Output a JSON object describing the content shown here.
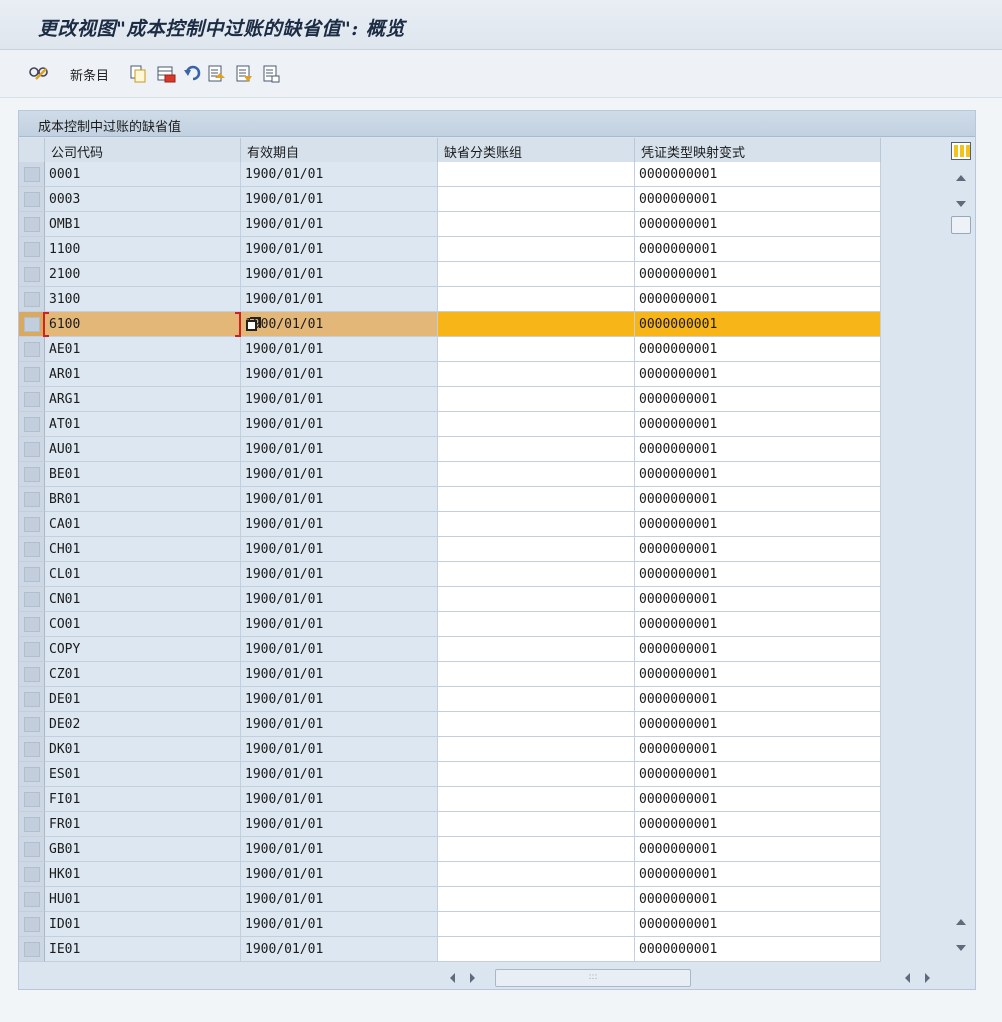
{
  "window": {
    "title": "更改视图\"成本控制中过账的缺省值\": 概览"
  },
  "toolbar": {
    "items": [
      {
        "icon": "glasses-icon"
      },
      {
        "label": "新条目",
        "icon": "new-entry"
      },
      {
        "icon": "copy-icon"
      },
      {
        "icon": "delete-icon"
      },
      {
        "icon": "undo-icon"
      },
      {
        "icon": "select-all-icon"
      },
      {
        "icon": "select-block-icon"
      },
      {
        "icon": "deselect-all-icon"
      }
    ]
  },
  "table": {
    "title": "成本控制中过账的缺省值",
    "columns": [
      "公司代码",
      "有效期自",
      "缺省分类账组",
      "凭证类型映射变式"
    ],
    "selected_row": 6,
    "rows": [
      [
        "0001",
        "1900/01/01",
        "",
        "0000000001"
      ],
      [
        "0003",
        "1900/01/01",
        "",
        "0000000001"
      ],
      [
        "OMB1",
        "1900/01/01",
        "",
        "0000000001"
      ],
      [
        "1100",
        "1900/01/01",
        "",
        "0000000001"
      ],
      [
        "2100",
        "1900/01/01",
        "",
        "0000000001"
      ],
      [
        "3100",
        "1900/01/01",
        "",
        "0000000001"
      ],
      [
        "6100",
        "1900/01/01",
        "",
        "0000000001"
      ],
      [
        "AE01",
        "1900/01/01",
        "",
        "0000000001"
      ],
      [
        "AR01",
        "1900/01/01",
        "",
        "0000000001"
      ],
      [
        "ARG1",
        "1900/01/01",
        "",
        "0000000001"
      ],
      [
        "AT01",
        "1900/01/01",
        "",
        "0000000001"
      ],
      [
        "AU01",
        "1900/01/01",
        "",
        "0000000001"
      ],
      [
        "BE01",
        "1900/01/01",
        "",
        "0000000001"
      ],
      [
        "BR01",
        "1900/01/01",
        "",
        "0000000001"
      ],
      [
        "CA01",
        "1900/01/01",
        "",
        "0000000001"
      ],
      [
        "CH01",
        "1900/01/01",
        "",
        "0000000001"
      ],
      [
        "CL01",
        "1900/01/01",
        "",
        "0000000001"
      ],
      [
        "CN01",
        "1900/01/01",
        "",
        "0000000001"
      ],
      [
        "CO01",
        "1900/01/01",
        "",
        "0000000001"
      ],
      [
        "COPY",
        "1900/01/01",
        "",
        "0000000001"
      ],
      [
        "CZ01",
        "1900/01/01",
        "",
        "0000000001"
      ],
      [
        "DE01",
        "1900/01/01",
        "",
        "0000000001"
      ],
      [
        "DE02",
        "1900/01/01",
        "",
        "0000000001"
      ],
      [
        "DK01",
        "1900/01/01",
        "",
        "0000000001"
      ],
      [
        "ES01",
        "1900/01/01",
        "",
        "0000000001"
      ],
      [
        "FI01",
        "1900/01/01",
        "",
        "0000000001"
      ],
      [
        "FR01",
        "1900/01/01",
        "",
        "0000000001"
      ],
      [
        "GB01",
        "1900/01/01",
        "",
        "0000000001"
      ],
      [
        "HK01",
        "1900/01/01",
        "",
        "0000000001"
      ],
      [
        "HU01",
        "1900/01/01",
        "",
        "0000000001"
      ],
      [
        "ID01",
        "1900/01/01",
        "",
        "0000000001"
      ],
      [
        "IE01",
        "1900/01/01",
        "",
        "0000000001"
      ]
    ]
  },
  "colors": {
    "selected_row": "#f7b517",
    "key_column_bg": "#dde7f1",
    "header_bg": "#d6e1ec"
  }
}
